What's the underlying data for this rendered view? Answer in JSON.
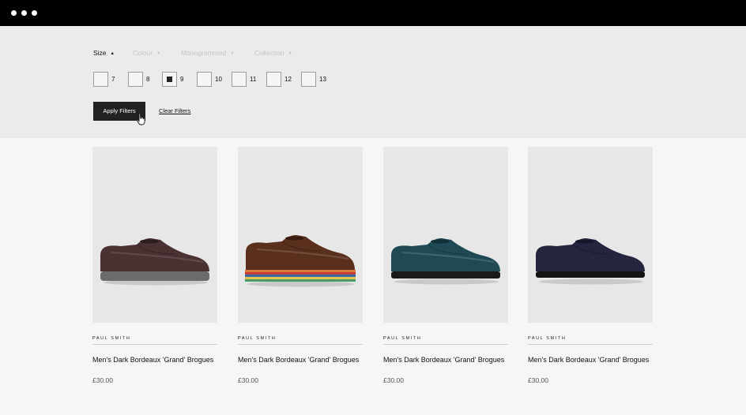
{
  "window": {
    "controls": [
      "dot",
      "dot",
      "dot"
    ]
  },
  "filters": {
    "tabs": [
      {
        "label": "Size",
        "arrow": "▲",
        "active": true
      },
      {
        "label": "Colour",
        "arrow": "▼",
        "active": false
      },
      {
        "label": "Monogrammed",
        "arrow": "▼",
        "active": false
      },
      {
        "label": "Collection",
        "arrow": "▼",
        "active": false
      }
    ],
    "sizes": [
      {
        "label": "7",
        "checked": false
      },
      {
        "label": "8",
        "checked": false
      },
      {
        "label": "9",
        "checked": true
      },
      {
        "label": "10",
        "checked": false
      },
      {
        "label": "11",
        "checked": false
      },
      {
        "label": "12",
        "checked": false
      },
      {
        "label": "13",
        "checked": false
      }
    ],
    "apply_label": "Apply Filters",
    "clear_label": "Clear Filters"
  },
  "products": [
    {
      "brand": "PAUL SMITH",
      "name": "Men's Dark Bordeaux  'Grand' Brogues",
      "price": "£30.00",
      "upper_color": "#4a3233",
      "sole_color": "#6b6b6b",
      "sole_style": "grey"
    },
    {
      "brand": "PAUL SMITH",
      "name": "Men's Dark Bordeaux 'Grand' Brogues",
      "price": "£30.00",
      "upper_color": "#5a2f1d",
      "sole_color": "#e0763a",
      "sole_style": "stripe"
    },
    {
      "brand": "PAUL SMITH",
      "name": "Men's Dark Bordeaux 'Grand' Brogues",
      "price": "£30.00",
      "upper_color": "#1f4a55",
      "sole_color": "#1a1a1a",
      "sole_style": "dark"
    },
    {
      "brand": "PAUL SMITH",
      "name": "Men's Dark Bordeaux 'Grand' Brogues",
      "price": "£30.00",
      "upper_color": "#25253f",
      "sole_color": "#141414",
      "sole_style": "dark"
    }
  ]
}
